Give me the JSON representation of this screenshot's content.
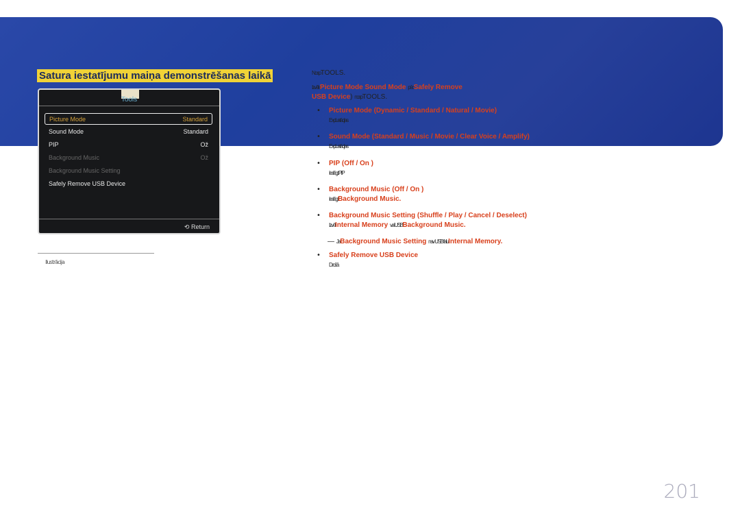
{
  "title": "Satura iestatījumu maiņa demonstrēšanas laikā",
  "menu": {
    "title": "Tools",
    "items": [
      {
        "label": "Picture Mode",
        "value": "Standard"
      },
      {
        "label": "Sound Mode",
        "value": "Standard"
      },
      {
        "label": "PIP",
        "value": "Ož"
      },
      {
        "label": "Background Music",
        "value": "Ož"
      },
      {
        "label": "Background Music Setting",
        "value": ""
      },
      {
        "label": "Safely Remove USB Device",
        "value": ""
      }
    ],
    "return_label": "Return"
  },
  "footnote": "Ilustrācija",
  "steps": {
    "s1_pre": "Nosp",
    "s1": "TOOLS.",
    "s2_pre": "Izvēle",
    "s2_a": "Picture Mode",
    "s2_b": "Sound Mode",
    "s2_mid": "pēc",
    "s2_c": "Safely Remove USB Device",
    "s2_post": "nosp",
    "s2_end": "TOOLS."
  },
  "items": [
    {
      "head": "Picture Mode",
      "opts": "(Dynamic / Standard / Natural / Movie)",
      "desc": "Expluatācijas"
    },
    {
      "head": "Sound Mode",
      "opts": "(Standard / Music / Movie / Clear Voice / Amplify)",
      "desc": "Expluatācijas"
    },
    {
      "head": "PIP",
      "opts": "(Off / On )",
      "desc": "Ieslēgt PIP"
    },
    {
      "head": "Background Music",
      "opts": "(Off / On )",
      "desc_pre": "Ieslēgt",
      "desc_red": "Background Music."
    },
    {
      "head": "Background Music Setting",
      "opts": "(Shuffle / Play / Cancel / Deselect)",
      "desc_pre": "Izvēl",
      "desc_red": "Internal Memory",
      "desc_mid": "vai USB",
      "desc_red2": "Background Music."
    },
    {
      "head": "Safely Remove USB Device",
      "desc": "Drošā"
    }
  ],
  "note": {
    "pre": "Ja",
    "red": "Background Music Setting",
    "mid": "nav USB failu",
    "red2": "Internal Memory."
  },
  "page_number": "201"
}
